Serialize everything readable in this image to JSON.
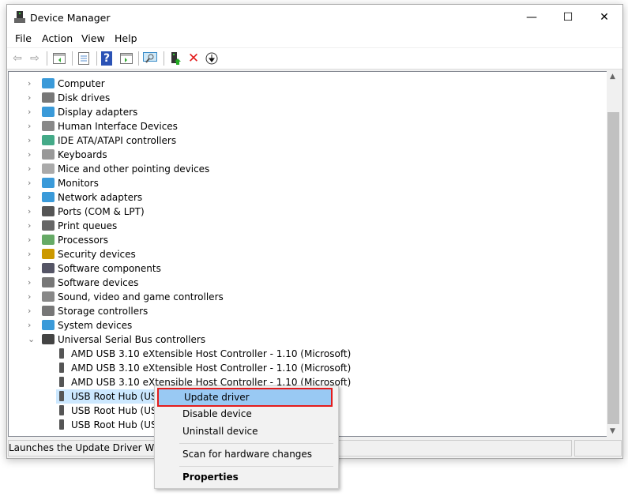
{
  "window": {
    "title": "Device Manager",
    "minimize": "—",
    "maximize": "☐",
    "close": "✕"
  },
  "menu": [
    "File",
    "Action",
    "View",
    "Help"
  ],
  "toolbar": {
    "icons": [
      "back-icon",
      "forward-icon",
      "show-hide-console-tree-icon",
      "properties-icon",
      "help-icon",
      "action-pane-icon",
      "scan-hardware-icon",
      "update-driver-icon",
      "uninstall-icon",
      "disable-icon"
    ]
  },
  "tree": {
    "categories": [
      {
        "label": "Computer",
        "icon": "computer-icon"
      },
      {
        "label": "Disk drives",
        "icon": "disk-icon"
      },
      {
        "label": "Display adapters",
        "icon": "display-icon"
      },
      {
        "label": "Human Interface Devices",
        "icon": "hid-icon"
      },
      {
        "label": "IDE ATA/ATAPI controllers",
        "icon": "ide-icon"
      },
      {
        "label": "Keyboards",
        "icon": "keyboard-icon"
      },
      {
        "label": "Mice and other pointing devices",
        "icon": "mouse-icon"
      },
      {
        "label": "Monitors",
        "icon": "monitor-icon"
      },
      {
        "label": "Network adapters",
        "icon": "network-icon"
      },
      {
        "label": "Ports (COM & LPT)",
        "icon": "port-icon"
      },
      {
        "label": "Print queues",
        "icon": "printer-icon"
      },
      {
        "label": "Processors",
        "icon": "processor-icon"
      },
      {
        "label": "Security devices",
        "icon": "security-icon"
      },
      {
        "label": "Software components",
        "icon": "software-component-icon"
      },
      {
        "label": "Software devices",
        "icon": "software-device-icon"
      },
      {
        "label": "Sound, video and game controllers",
        "icon": "sound-icon"
      },
      {
        "label": "Storage controllers",
        "icon": "storage-icon"
      },
      {
        "label": "System devices",
        "icon": "system-icon"
      },
      {
        "label": "Universal Serial Bus controllers",
        "icon": "usb-icon"
      }
    ],
    "usb_children": [
      "AMD USB 3.10 eXtensible Host Controller - 1.10 (Microsoft)",
      "AMD USB 3.10 eXtensible Host Controller - 1.10 (Microsoft)",
      "AMD USB 3.10 eXtensible Host Controller - 1.10 (Microsoft)",
      "USB Root Hub (USB",
      "USB Root Hub (USB",
      "USB Root Hub (USB"
    ]
  },
  "context_menu": {
    "update": "Update driver",
    "disable": "Disable device",
    "uninstall": "Uninstall device",
    "scan": "Scan for hardware changes",
    "properties": "Properties"
  },
  "status": "Launches the Update Driver Wizard",
  "colors": {
    "highlight": "#99c9f3",
    "outline": "#e31c1c",
    "selected_row": "#cce8ff"
  }
}
